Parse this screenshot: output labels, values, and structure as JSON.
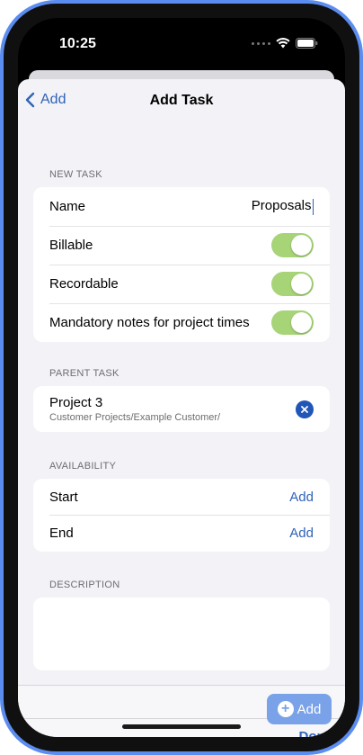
{
  "status_bar": {
    "time": "10:25"
  },
  "nav": {
    "back_label": "Add",
    "title": "Add Task"
  },
  "new_task": {
    "header": "New Task",
    "name_label": "Name",
    "name_value": "Proposals",
    "billable_label": "Billable",
    "billable_on": true,
    "recordable_label": "Recordable",
    "recordable_on": true,
    "mandatory_label": "Mandatory notes for project times",
    "mandatory_on": true
  },
  "parent_task": {
    "header": "Parent Task",
    "title": "Project 3",
    "path": "Customer Projects/Example Customer/"
  },
  "availability": {
    "header": "Availability",
    "start_label": "Start",
    "start_action": "Add",
    "end_label": "End",
    "end_action": "Add"
  },
  "description": {
    "header": "Description",
    "value": ""
  },
  "toolbar": {
    "add_label": "Add",
    "done_label": "Done"
  },
  "colors": {
    "accent": "#2e63b8",
    "toggle_on": "#a6d477",
    "frame": "#5b8df0",
    "background": "#f2f2f7"
  }
}
